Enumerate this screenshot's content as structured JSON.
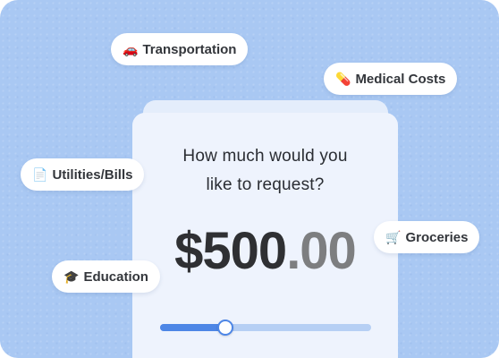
{
  "question": "How much would you\nlike to request?",
  "amount": {
    "dollars": "$500",
    "cents": ".00"
  },
  "slider": {
    "fraction": 0.31,
    "track_color": "#b6cff4",
    "fill_color": "#4d86e6"
  },
  "categories": [
    {
      "icon": "🚗",
      "icon_name": "car-icon",
      "label": "Transportation"
    },
    {
      "icon": "💊",
      "icon_name": "pill-icon",
      "label": "Medical Costs"
    },
    {
      "icon": "📄",
      "icon_name": "document-icon",
      "label": "Utilities/Bills"
    },
    {
      "icon": "🛒",
      "icon_name": "shopping-cart-icon",
      "label": "Groceries"
    },
    {
      "icon": "🎓",
      "icon_name": "graduation-cap-icon",
      "label": "Education"
    }
  ],
  "colors": {
    "background": "#a9c8f3",
    "card": "#eef3fd",
    "accent": "#4d86e6",
    "amount": "#2f3033"
  }
}
